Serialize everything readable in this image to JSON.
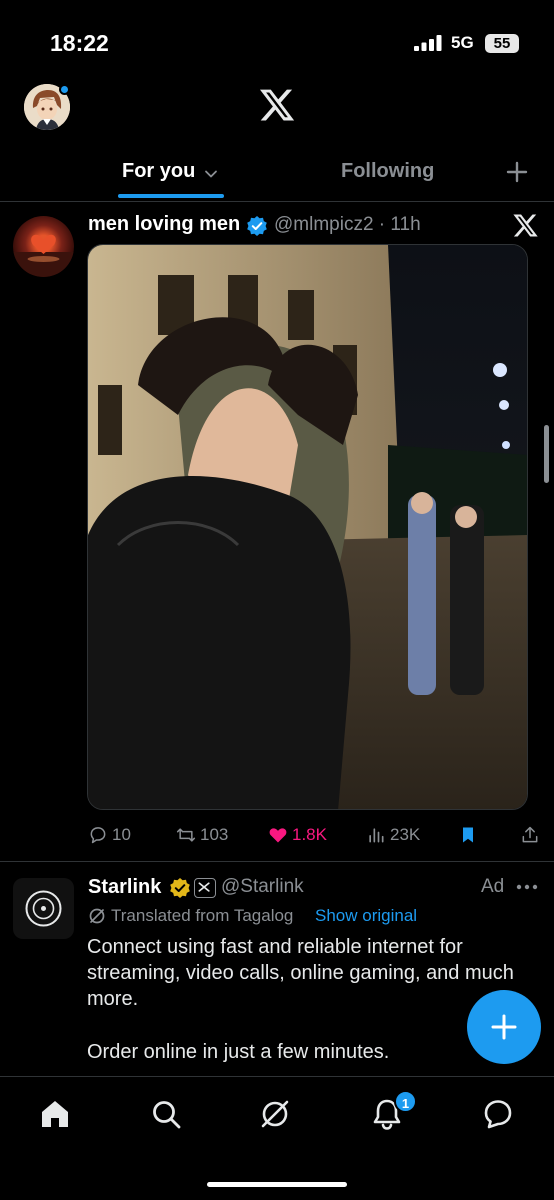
{
  "status_bar": {
    "time": "18:22",
    "network": "5G",
    "battery": "55"
  },
  "header": {
    "logo": "x-logo"
  },
  "tabs": [
    {
      "label": "For you",
      "active": true
    },
    {
      "label": "Following",
      "active": false
    }
  ],
  "tweet": {
    "display_name": "men loving men",
    "handle_time": "@mlmpicz2 · 11h",
    "actions": {
      "replies": "10",
      "retweets": "103",
      "likes": "1.8K",
      "views": "23K"
    }
  },
  "ad": {
    "display_name": "Starlink",
    "handle": "@Starlink",
    "label": "Ad",
    "translated": "Translated from Tagalog",
    "show_original": "Show original",
    "text": "Connect using fast and reliable internet for streaming, video calls, online gaming, and much more.",
    "text2": "Order online in just a few minutes."
  },
  "bottom_nav": {
    "notification_count": "1"
  },
  "colors": {
    "accent": "#1d9bf0",
    "like": "#f91880",
    "muted": "#8b8f94",
    "background": "#000000"
  }
}
